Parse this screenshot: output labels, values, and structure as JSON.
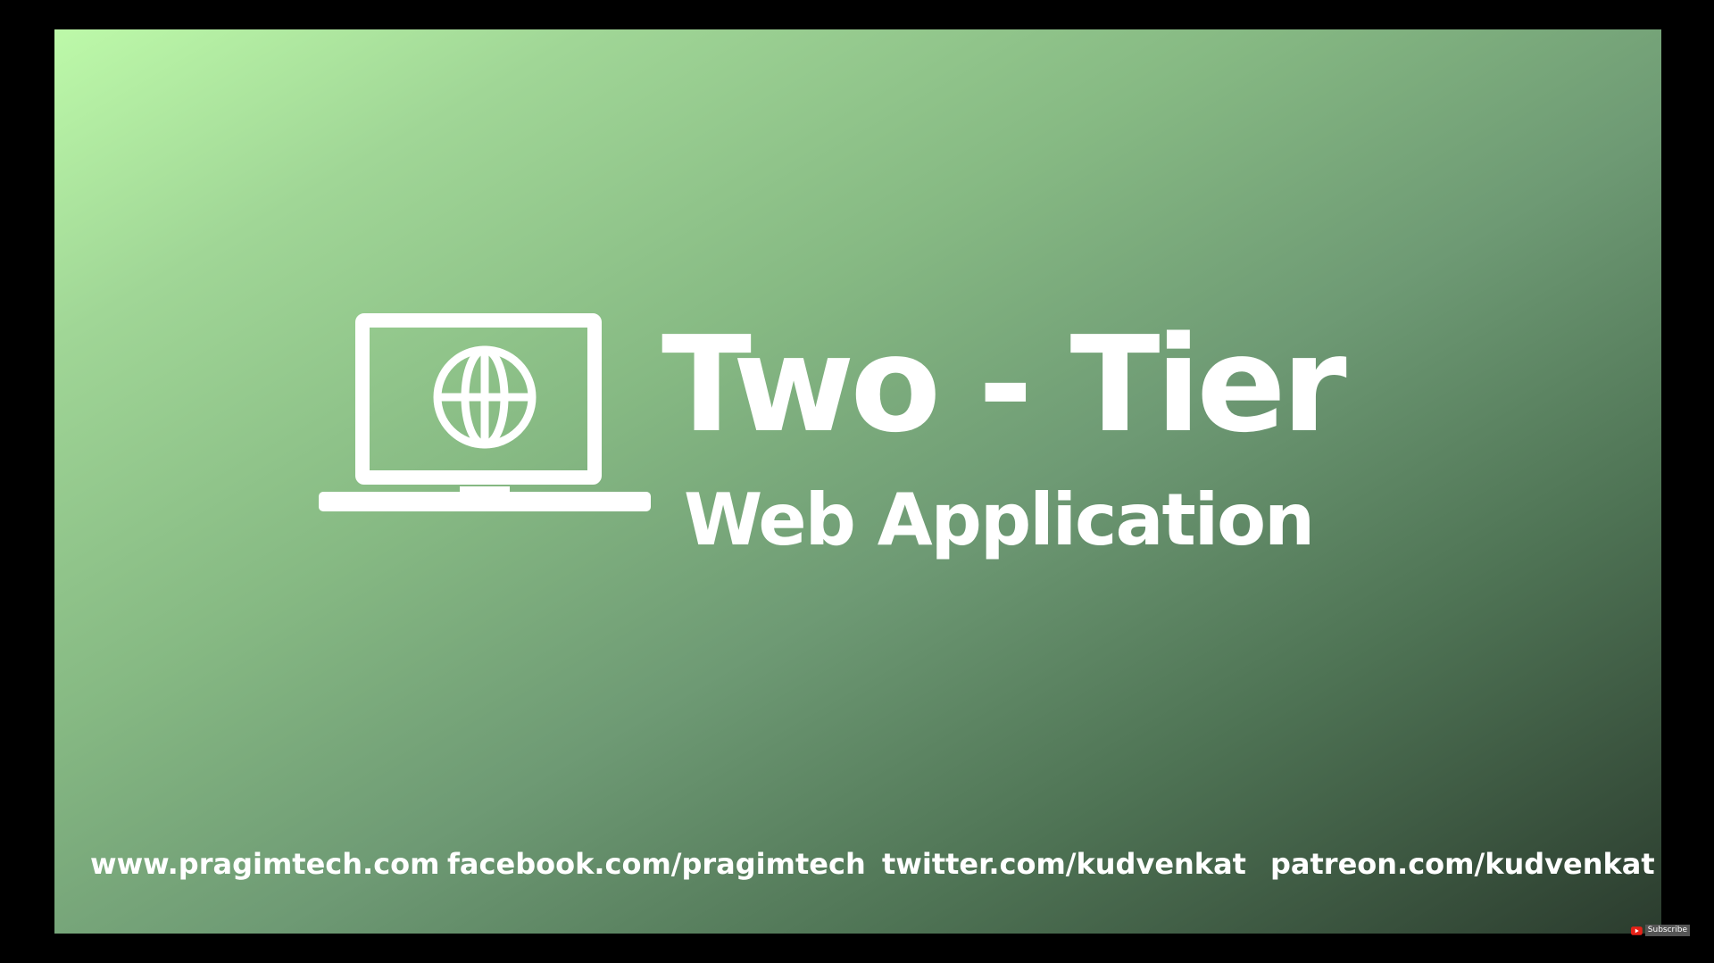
{
  "slide": {
    "title": "Two - Tier",
    "subtitle": "Web Application",
    "icon": "laptop-globe-icon"
  },
  "footer": {
    "links": [
      "www.pragimtech.com",
      "facebook.com/pragimtech",
      "twitter.com/kudvenkat",
      "patreon.com/kudvenkat"
    ]
  },
  "overlay": {
    "subscribe_label": "Subscribe",
    "icon": "youtube-icon"
  }
}
